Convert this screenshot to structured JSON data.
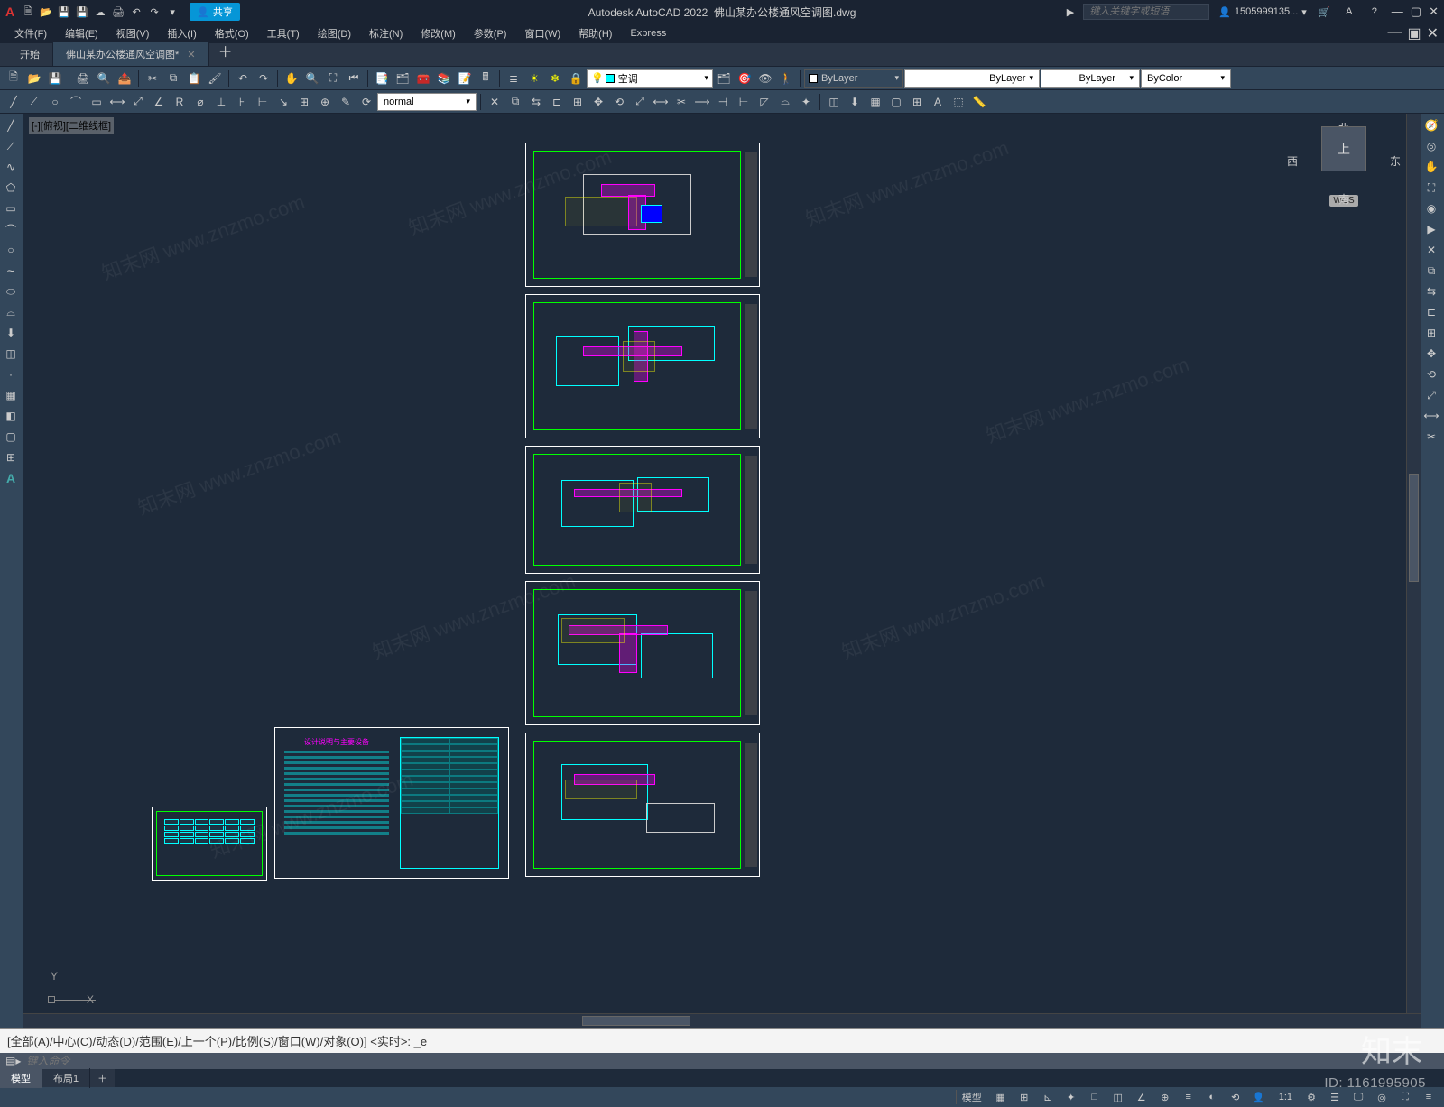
{
  "app": {
    "title_prefix": "Autodesk AutoCAD 2022",
    "filename": "佛山某办公楼通风空调图.dwg",
    "share_label": "共享",
    "search_placeholder": "键入关键字或短语",
    "username": "1505999135...",
    "logo_glyph": "A"
  },
  "menus": [
    "文件(F)",
    "编辑(E)",
    "视图(V)",
    "插入(I)",
    "格式(O)",
    "工具(T)",
    "绘图(D)",
    "标注(N)",
    "修改(M)",
    "参数(P)",
    "窗口(W)",
    "帮助(H)",
    "Express"
  ],
  "file_tabs": {
    "items": [
      {
        "label": "开始",
        "active": false,
        "closable": false
      },
      {
        "label": "佛山某办公楼通风空调图*",
        "active": true,
        "closable": true
      }
    ]
  },
  "toolbar1": {
    "layer_current": "空调",
    "layer_list_label": "ByLayer",
    "linetype_label": "ByLayer",
    "lineweight_label": "ByLayer",
    "plotstyle_label": "ByColor"
  },
  "toolbar2": {
    "text_style": "normal"
  },
  "canvas": {
    "viewport_label": "[-][俯视][二维线框]",
    "navcube": {
      "n": "北",
      "s": "南",
      "e": "东",
      "w": "西",
      "face": "上",
      "wcs": "WCS"
    },
    "ucs": {
      "x": "X",
      "y": "Y"
    }
  },
  "command": {
    "history_line": "[全部(A)/中心(C)/动态(D)/范围(E)/上一个(P)/比例(S)/窗口(W)/对象(O)] <实时>: _e",
    "prompt_placeholder": "键入命令"
  },
  "layout_tabs": [
    "模型",
    "布局1"
  ],
  "statusbar": {
    "model_label": "模型",
    "scale": "1:1"
  },
  "watermark": {
    "text": "知末网 www.znzmo.com",
    "logo": "知末",
    "id": "ID: 1161995905"
  }
}
